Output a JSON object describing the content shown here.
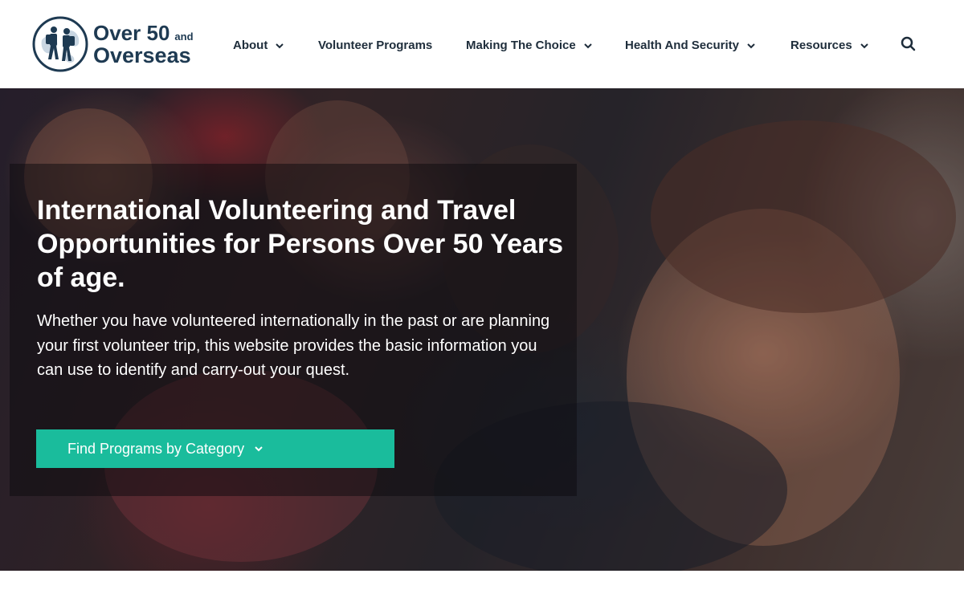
{
  "brand": {
    "line1": "Over 50",
    "and": "and",
    "line2": "Overseas"
  },
  "nav": [
    {
      "label": "About",
      "has_dropdown": true
    },
    {
      "label": "Volunteer Programs",
      "has_dropdown": false
    },
    {
      "label": "Making The Choice",
      "has_dropdown": true
    },
    {
      "label": "Health And Security",
      "has_dropdown": true
    },
    {
      "label": "Resources",
      "has_dropdown": true
    }
  ],
  "search": {
    "icon": "search-icon"
  },
  "hero": {
    "title": "International Volunteering and Travel Opportunities for Persons Over 50 Years of age.",
    "description": "Whether you have volunteered internationally in the past or are planning your first volunteer trip, this website provides the basic information you can use to identify and carry-out your quest.",
    "cta_label": "Find Programs by Category",
    "cta_icon": "chevron-down-icon"
  },
  "colors": {
    "brand_navy": "#1e3a52",
    "accent_teal": "#1abc9c",
    "nav_text": "#1e2d3b"
  }
}
